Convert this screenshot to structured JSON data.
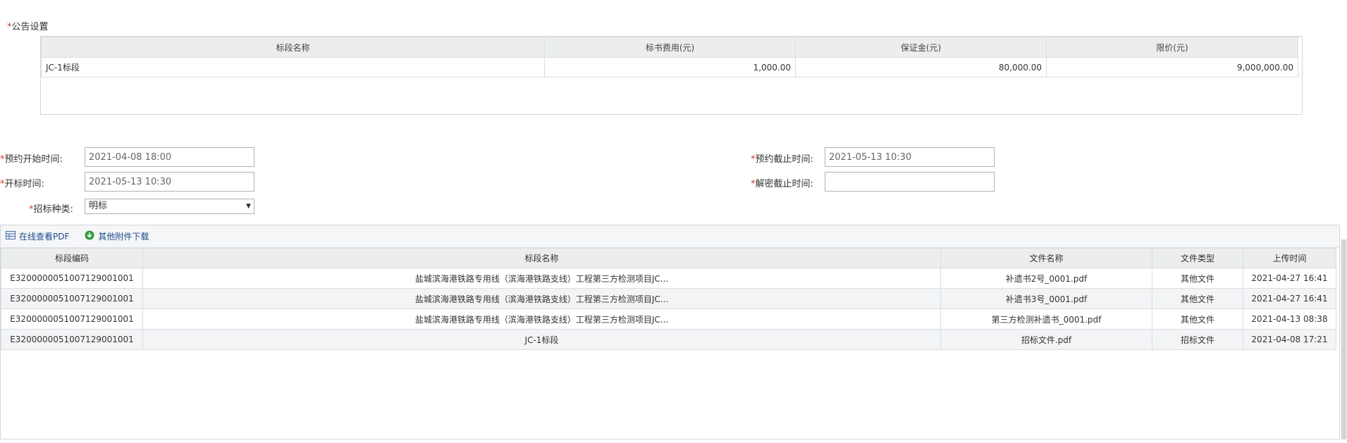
{
  "announcement": {
    "title": "公告设置",
    "columns": [
      "标段名称",
      "标书费用(元)",
      "保证金(元)",
      "限价(元)"
    ],
    "rows": [
      {
        "name": "JC-1标段",
        "doc_fee": "1,000.00",
        "deposit": "80,000.00",
        "limit": "9,000,000.00"
      }
    ]
  },
  "form": {
    "required_mark": "*",
    "reserve_start_label": "预约开始时间:",
    "reserve_start_value": "2021-04-08 18:00",
    "reserve_end_label": "预约截止时间:",
    "reserve_end_value": "2021-05-13 10:30",
    "open_label": "开标时间:",
    "open_value": "2021-05-13 10:30",
    "decrypt_label": "解密截止时间:",
    "decrypt_value": "",
    "tender_type_label": "招标种类:",
    "tender_type_value": "明标"
  },
  "attachments": {
    "toolbar": {
      "view_pdf": "在线查看PDF",
      "download": "其他附件下载"
    },
    "columns": [
      "标段编码",
      "标段名称",
      "文件名称",
      "文件类型",
      "上传时间"
    ],
    "rows": [
      {
        "code": "E3200000051007129001001",
        "name": "盐城滨海港铁路专用线（滨海港铁路支线）工程第三方检测项目JC...",
        "file": "补遗书2号_0001.pdf",
        "type": "其他文件",
        "time": "2021-04-27 16:41"
      },
      {
        "code": "E3200000051007129001001",
        "name": "盐城滨海港铁路专用线（滨海港铁路支线）工程第三方检测项目JC...",
        "file": "补遗书3号_0001.pdf",
        "type": "其他文件",
        "time": "2021-04-27 16:41"
      },
      {
        "code": "E3200000051007129001001",
        "name": "盐城滨海港铁路专用线（滨海港铁路支线）工程第三方检测项目JC...",
        "file": "第三方检测补遗书_0001.pdf",
        "type": "其他文件",
        "time": "2021-04-13 08:38"
      },
      {
        "code": "E3200000051007129001001",
        "name": "JC-1标段",
        "file": "招标文件.pdf",
        "type": "招标文件",
        "time": "2021-04-08 17:21"
      }
    ]
  },
  "colors": {
    "required": "#e0322d",
    "link": "#1b4a8c",
    "header_bg": "#eceded"
  }
}
